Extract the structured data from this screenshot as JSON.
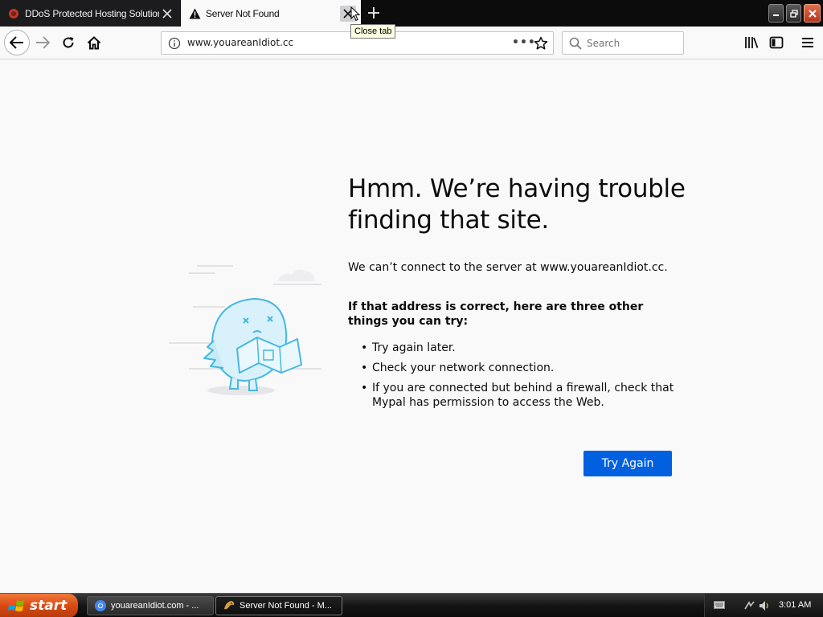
{
  "browser": {
    "tabs": [
      {
        "title": "DDoS Protected Hosting Solutions",
        "favicon": "shield-icon",
        "active": false
      },
      {
        "title": "Server Not Found",
        "favicon": "warning-icon",
        "active": true
      }
    ],
    "tooltip": "Close tab",
    "url": "www.youareanIdiot.cc",
    "search_placeholder": "Search",
    "page_actions": "•••"
  },
  "error_page": {
    "title": "Hmm. We’re having trouble finding that site.",
    "description": "We can’t connect to the server at www.youareanIdiot.cc.",
    "hint": "If that address is correct, here are three other things you can try:",
    "suggestions": [
      "Try again later.",
      "Check your network connection.",
      "If you are connected but behind a firewall, check that Mypal has permission to access the Web."
    ],
    "button_label": "Try Again",
    "accent_color": "#0060df"
  },
  "taskbar": {
    "start_label": "start",
    "tasks": [
      {
        "label": "youareanIdiot.com - ..."
      },
      {
        "label": "Server Not Found - M..."
      }
    ],
    "clock": "3:01 AM"
  }
}
